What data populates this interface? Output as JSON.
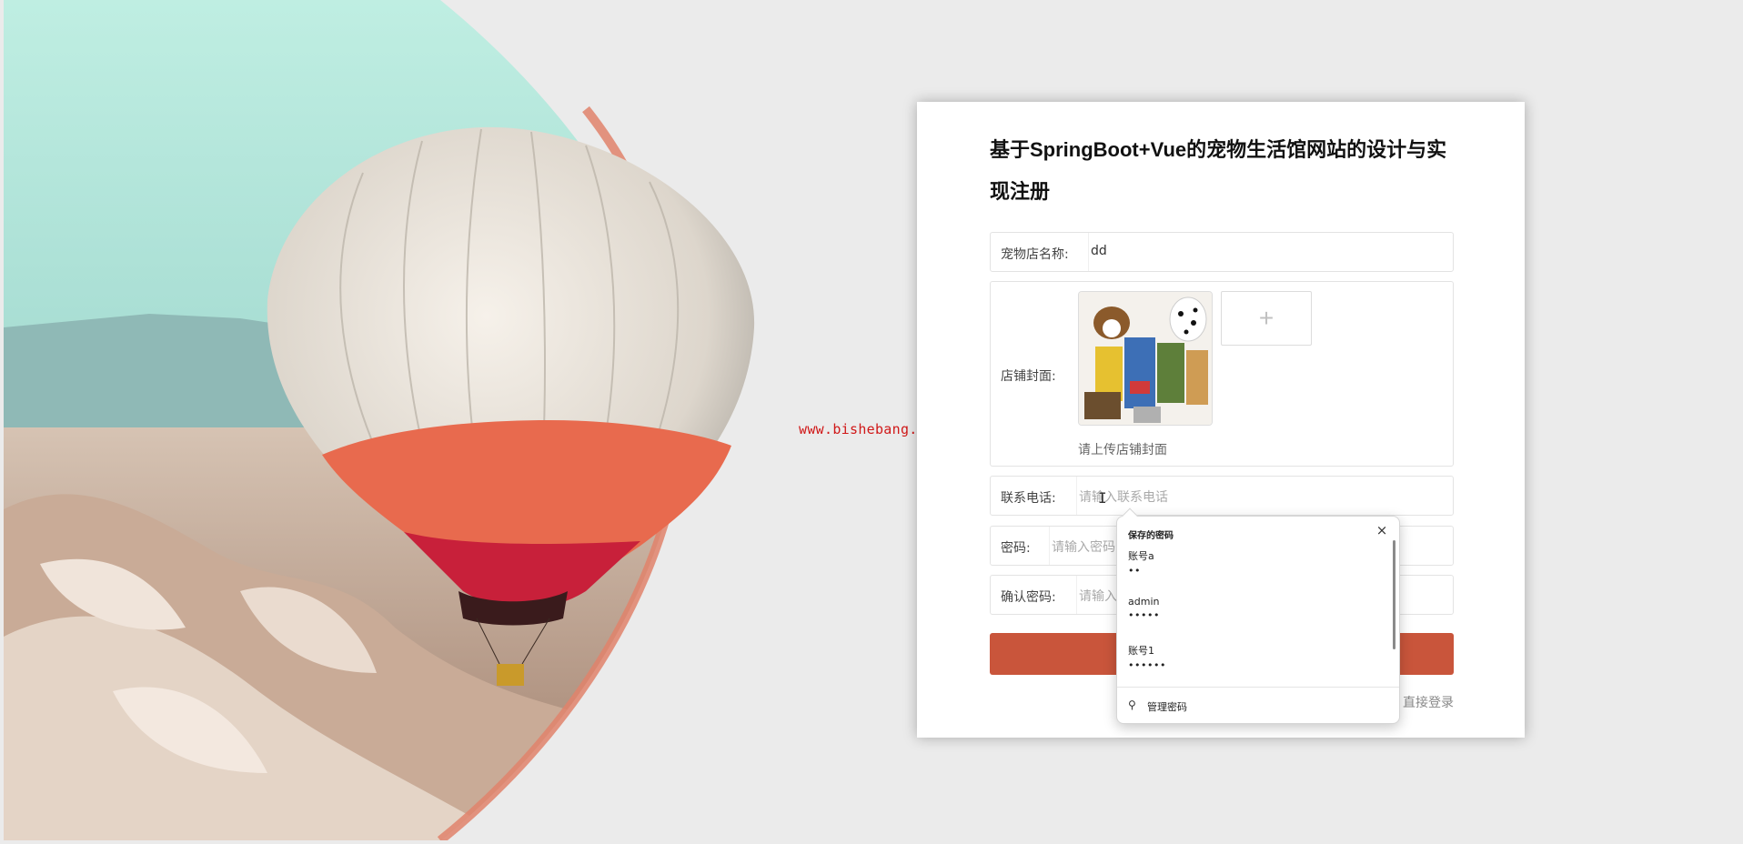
{
  "watermark": "www.bishebang.site",
  "form": {
    "title": "基于SpringBoot+Vue的宠物生活馆网站的设计与实现注册",
    "shop_name": {
      "label": "宠物店名称:",
      "value": "dd"
    },
    "cover": {
      "label": "店铺封面:",
      "hint": "请上传店铺封面",
      "add_icon": "+"
    },
    "phone": {
      "label": "联系电话:",
      "placeholder": "请输入联系电话"
    },
    "password": {
      "label": "密码:",
      "placeholder": "请输入密码"
    },
    "confirm_password": {
      "label": "确认密码:",
      "placeholder": "请输入"
    },
    "login_link": "直接登录"
  },
  "password_popup": {
    "heading": "保存的密码",
    "close_icon": "×",
    "items": [
      {
        "user": "账号a",
        "dots": "••"
      },
      {
        "user": "admin",
        "dots": "•••••"
      },
      {
        "user": "账号1",
        "dots": "••••••"
      }
    ],
    "manage_label": "管理密码",
    "key_icon": "⚲"
  },
  "colors": {
    "accent": "#c9553b",
    "background": "#ebebeb",
    "watermark": "#d01818"
  }
}
